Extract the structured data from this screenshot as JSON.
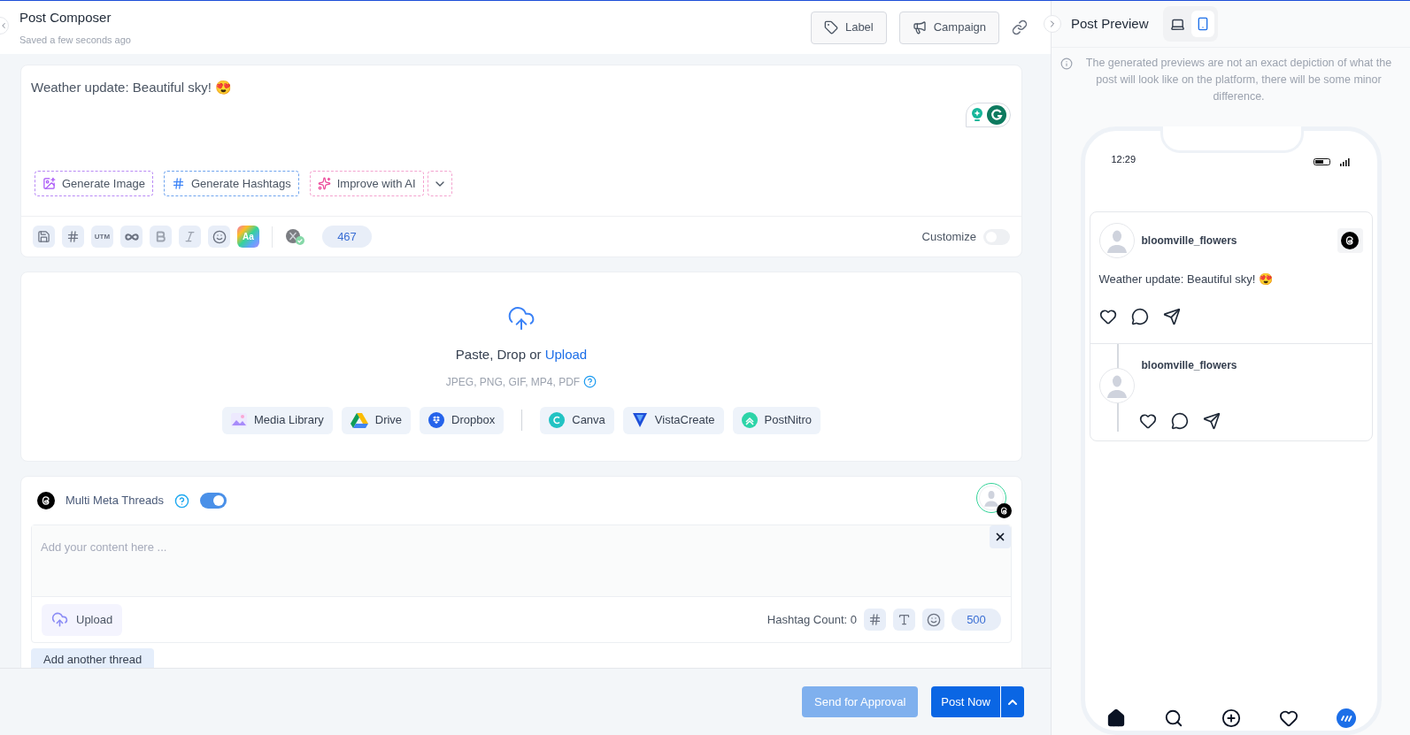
{
  "header": {
    "title": "Post Composer",
    "subtitle": "Saved a few seconds ago",
    "buttons": [
      {
        "kind": "label",
        "label": "Label"
      },
      {
        "kind": "campaign",
        "label": "Campaign"
      }
    ]
  },
  "editor": {
    "text": "Weather update: Beautiful sky! 😍",
    "ai_actions": [
      {
        "kind": "image",
        "label": "Generate Image"
      },
      {
        "kind": "hashtags",
        "label": "Generate Hashtags"
      },
      {
        "kind": "improve",
        "label": "Improve with AI"
      }
    ],
    "tools": [
      {
        "kind": "save"
      },
      {
        "kind": "hashtag"
      },
      {
        "kind": "utm",
        "label": "UTM"
      },
      {
        "kind": "link"
      },
      {
        "kind": "bold"
      },
      {
        "kind": "italic"
      },
      {
        "kind": "emoji"
      },
      {
        "kind": "font",
        "label": "Aa"
      }
    ],
    "char_count": "467",
    "customize": {
      "label": "Customize",
      "on": false
    }
  },
  "media": {
    "prompt": "Paste, Drop or",
    "link": "Upload",
    "formats": "JPEG, PNG, GIF, MP4, PDF",
    "storage": [
      {
        "kind": "library",
        "label": "Media Library"
      },
      {
        "kind": "drive",
        "label": "Drive"
      },
      {
        "kind": "dropbox",
        "label": "Dropbox"
      }
    ],
    "design_tools": [
      {
        "kind": "canva",
        "label": "Canva"
      },
      {
        "kind": "vista",
        "label": "VistaCreate"
      },
      {
        "kind": "postnitro",
        "label": "PostNitro"
      }
    ]
  },
  "thread": {
    "title": "Multi Meta Threads",
    "on": true,
    "placeholder": "Add your content here ...",
    "upload": "Upload",
    "hashtag_count": "Hashtag Count: 0",
    "char_count": "500",
    "add_button": "Add another thread"
  },
  "footer": {
    "approval": "Send for Approval",
    "post": "Post Now"
  },
  "preview": {
    "title": "Post Preview",
    "devices": [
      {
        "kind": "desktop",
        "selected": false
      },
      {
        "kind": "mobile",
        "selected": true
      }
    ],
    "notice": "The generated previews are not an exact depiction of what the post will look like on the platform, there will be some minor difference.",
    "time": "12:29",
    "posts": [
      {
        "username": "bloomville_flowers",
        "text": "Weather update: Beautiful sky! 😍"
      },
      {
        "username": "bloomville_flowers"
      }
    ]
  }
}
